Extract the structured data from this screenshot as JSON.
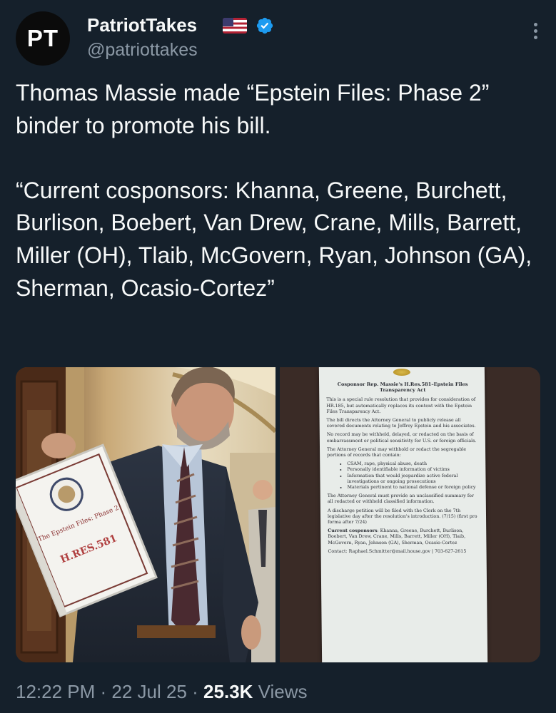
{
  "author": {
    "avatar_text": "PT",
    "display_name": "PatriotTakes",
    "handle": "@patriottakes",
    "flag_icon": "us-flag",
    "verified_icon": "verified-badge",
    "verified_color": "#1d9bf0"
  },
  "tweet": {
    "text": "Thomas Massie made “Epstein Files: Phase 2” binder to promote his bill.\n\n“Current cosponsors: Khanna, Greene, Burchett, Burlison, Boebert, Van Drew, Crane, Mills, Barrett, Miller (OH), Tlaib, McGovern, Ryan, Johnson (GA), Sherman, Ocasio-Cortez”"
  },
  "photo_left": {
    "binder_text": "The Epstein Files: Phase 2",
    "binder_stamp": "H.RES.581"
  },
  "document": {
    "title": "Cosponsor Rep. Massie's H.Res.581–Epstein Files Transparency Act",
    "p1": "This is a special rule resolution that provides for consideration of HR.185, but automatically replaces its content with the Epstein Files Transparency Act.",
    "p2": "The bill directs the Attorney General to publicly release all covered documents relating to Jeffrey Epstein and his associates.",
    "p3": "No record may be withheld, delayed, or redacted on the basis of embarrassment or political sensitivity for U.S. or foreign officials.",
    "p4": "The Attorney General may withhold or redact the segregable portions of records that contain:",
    "bullets": [
      "CSAM, rape, physical abuse, death",
      "Personally identifiable information of victims",
      "Information that would jeopardize active federal investigations or ongoing prosecutions",
      "Materials pertinent to national defense or foreign policy"
    ],
    "p5": "The Attorney General must provide an unclassified summary for all redacted or withheld classified information.",
    "p6": "A discharge petition will be filed with the Clerk on the 7th legislative day after the resolution's introduction. (7/15) (first pro forma after 7/24)",
    "cosponsors_label": "Current cosponsors",
    "cosponsors": ": Khanna, Greene, Burchett, Burlison, Boebert, Van Drew, Crane, Mills, Barrett, Miller (OH), Tlaib, McGovern, Ryan, Johnson (GA), Sherman, Ocasio-Cortez",
    "contact": "Contact: Raphael.Schmitter@mail.house.gov | 703-627-2615"
  },
  "meta": {
    "time": "12:22 PM",
    "separator1": " · ",
    "date": "22 Jul 25",
    "separator2": " · ",
    "views_count": "25.3K",
    "views_label": " Views"
  },
  "colors": {
    "background": "#15202b",
    "text_primary": "#f7f9f9",
    "text_secondary": "#8b98a5"
  }
}
